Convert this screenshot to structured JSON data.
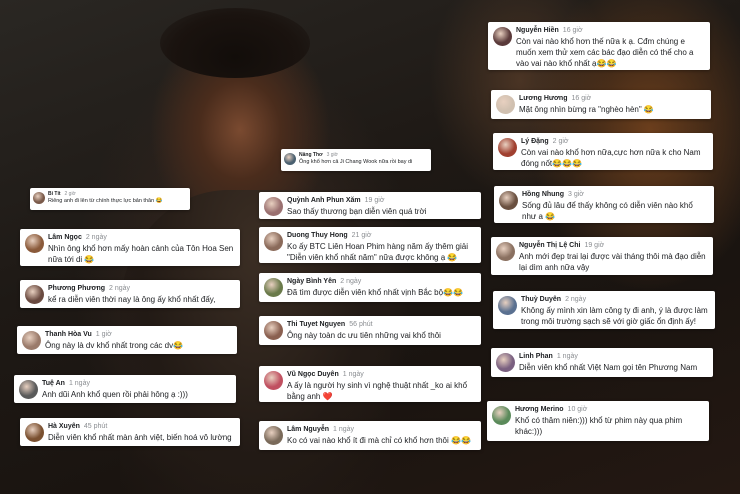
{
  "comments": [
    {
      "name": "Bi Tít",
      "time": "2 giờ",
      "text": "Riêng anh đi lên từ chính thực lực bản thân 😂",
      "avatar": "#7a5a4a"
    },
    {
      "name": "Lâm Ngọc",
      "time": "2 ngày",
      "text": "Nhìn ông khổ hơn mấy hoàn cảnh của Tôn Hoa Sen nữa tới di 😂",
      "avatar": "#8a5a3a"
    },
    {
      "name": "Phương Phương",
      "time": "2 ngày",
      "text": "kể ra diễn viên thời nay là ông ấy khổ nhất đấy,",
      "avatar": "#6a4a40"
    },
    {
      "name": "Thanh Hòa Vu",
      "time": "1 giờ",
      "text": "Ông này là dv khổ nhất trong các dv😂",
      "avatar": "#9a7a6a"
    },
    {
      "name": "Tuệ An",
      "time": "1 ngày",
      "text": "Anh dũi Anh khổ quen rồi phải hông ạ :)))",
      "avatar": "#5a5a5a"
    },
    {
      "name": "Hà Xuyên",
      "time": "45 phút",
      "text": "Diễn viên khổ nhất màn ảnh việt, biến hoá vô lường",
      "avatar": "#7a5030"
    },
    {
      "name": "Nâng Thơ",
      "time": "3 giờ",
      "text": "Ông khổ hơn cả Ji Chang Wook nữa rồi bay di",
      "avatar": "#4a6070"
    },
    {
      "name": "Quỳnh Anh Phun Xăm",
      "time": "19 giờ",
      "text": "Sao thấy thương bạn diễn viên quá trời",
      "avatar": "#9a7070"
    },
    {
      "name": "Duong Thuy Hong",
      "time": "21 giờ",
      "text": "Ko ấy BTC Liên Hoan Phim hàng năm ấy thêm giải \"Diễn viên khổ nhất năm\" nữa được không ạ 😂",
      "avatar": "#8a6a5a"
    },
    {
      "name": "Ngày Bình Yên",
      "time": "2 ngày",
      "text": "Đã tìm được diễn viên khổ nhất vịnh Bắc bộ😂😂",
      "avatar": "#6a7a4a"
    },
    {
      "name": "Thi Tuyet Nguyen",
      "time": "56 phút",
      "text": "Ông này toàn dc ưu tiên những vai khổ thôi",
      "avatar": "#8a6050"
    },
    {
      "name": "Vũ Ngọc Duyên",
      "time": "1 ngày",
      "text": "A ấy là người hy sinh vì nghệ thuật nhất _ko ai khổ bằng anh ❤️",
      "avatar": "#c05060"
    },
    {
      "name": "Lâm Nguyễn",
      "time": "1 ngày",
      "text": "Ko có vai nào khổ ít đi mà chỉ có khổ hơn thôi 😂😂",
      "avatar": "#7a6a5a"
    },
    {
      "name": "Nguyễn Hiền",
      "time": "16 giờ",
      "text": "Còn vai nào khổ hơn thế nữa k ạ. Cđm chúng e muốn xem thử xem các bác đạo diễn có thể cho a vào vai nào khổ nhất ạ😂😂",
      "avatar": "#5a3a3a"
    },
    {
      "name": "Lương Hương",
      "time": "16 giờ",
      "text": "Mặt ông nhìn bừng ra \"nghèo hèn\" 😂",
      "avatar": "#d0c0b0"
    },
    {
      "name": "Lý Đặng",
      "time": "2 giờ",
      "text": "Còn vai nào khổ hơn nữa,cực hơn nữa k cho  Nam đóng nốt😂😂😂",
      "avatar": "#a04030"
    },
    {
      "name": "Hồng Nhung",
      "time": "3 giờ",
      "text": "Sống đủ lâu để thấy không có diễn viên nào khổ như a 😂",
      "avatar": "#6a5040"
    },
    {
      "name": "Nguyễn Thị Lệ Chi",
      "time": "19 giờ",
      "text": "Anh mới đẹp trai lại được vài tháng thôi mà đạo diễn lại dìm anh nữa vậy",
      "avatar": "#8a7060"
    },
    {
      "name": "Thuỳ Duyên",
      "time": "2 ngày",
      "text": "Không ấy mình xin làm công ty đi anh, ý là được làm trong môi trường sạch sẽ với giờ giấc ổn định ấy!",
      "avatar": "#5a7090"
    },
    {
      "name": "Linh Phan",
      "time": "1 ngày",
      "text": "Diễn viên khổ nhất Việt Nam gọi tên Phương Nam",
      "avatar": "#7a6080"
    },
    {
      "name": "Hương Merino",
      "time": "10 giờ",
      "text": "Khổ có thâm niên:))) khổ từ phim này qua phim khác:)))",
      "avatar": "#5a8a5a"
    }
  ]
}
